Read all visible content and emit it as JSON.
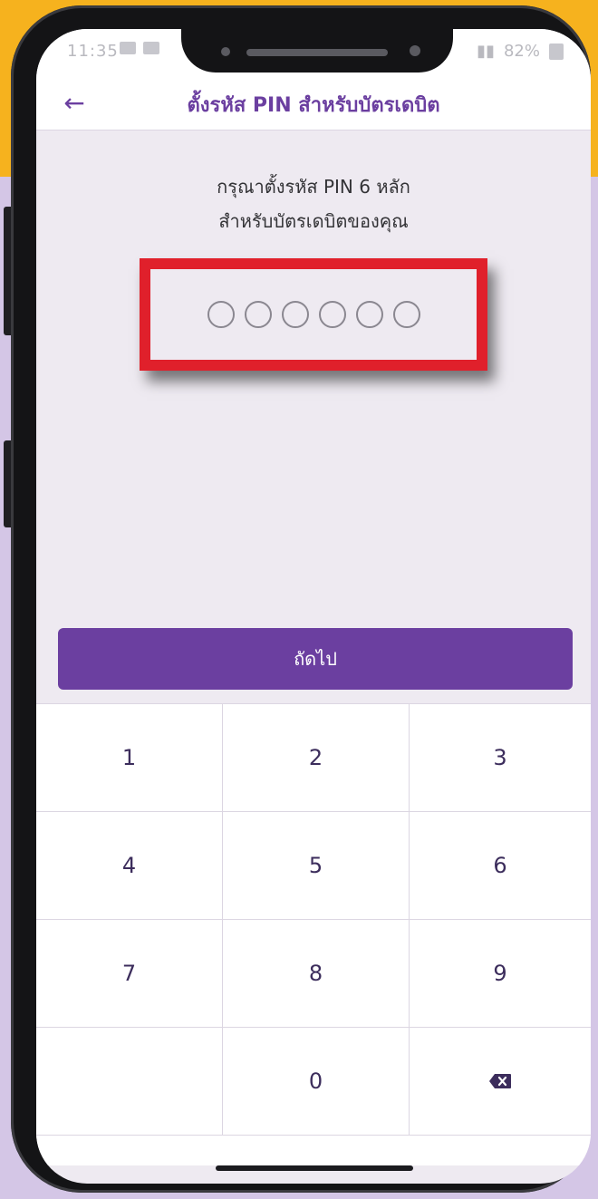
{
  "status_bar": {
    "time": "11:35",
    "battery": "82%"
  },
  "header": {
    "title": "ตั้งรหัส PIN สำหรับบัตรเดบิต"
  },
  "prompt": {
    "line1": "กรุณาตั้งรหัส PIN 6 หลัก",
    "line2": "สำหรับบัตรเดบิตของคุณ"
  },
  "pin": {
    "length": 6,
    "entered": 0
  },
  "next_button": {
    "label": "ถัดไป"
  },
  "keypad": {
    "keys": [
      "1",
      "2",
      "3",
      "4",
      "5",
      "6",
      "7",
      "8",
      "9",
      "",
      "0",
      "backspace-icon"
    ]
  },
  "colors": {
    "accent": "#6b3fa0",
    "highlight": "#e0202b",
    "background_top": "#f6b21e",
    "background": "#d4c6e6"
  }
}
